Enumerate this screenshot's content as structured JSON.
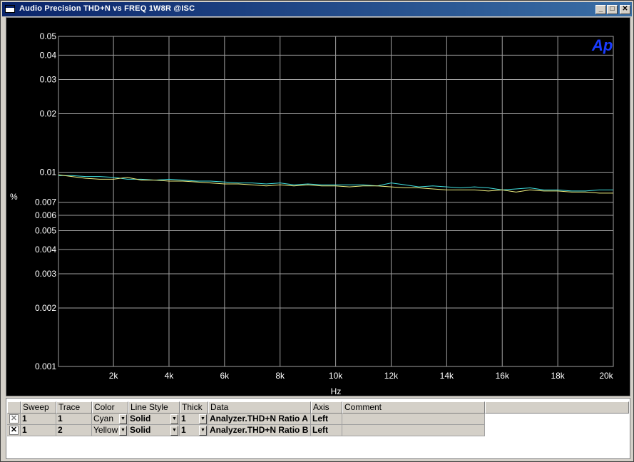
{
  "window": {
    "title": "Audio Precision  THD+N vs FREQ 1W8R @ISC",
    "min_glyph": "_",
    "max_glyph": "□",
    "close_glyph": "✕"
  },
  "logo": "Ap",
  "chart_data": {
    "type": "line",
    "xlabel": "Hz",
    "ylabel": "%",
    "xlim": [
      20,
      20000
    ],
    "ylim": [
      0.001,
      0.05
    ],
    "yscale": "log",
    "grid": true,
    "x_ticks": [
      {
        "v": 2000,
        "label": "2k"
      },
      {
        "v": 4000,
        "label": "4k"
      },
      {
        "v": 6000,
        "label": "6k"
      },
      {
        "v": 8000,
        "label": "8k"
      },
      {
        "v": 10000,
        "label": "10k"
      },
      {
        "v": 12000,
        "label": "12k"
      },
      {
        "v": 14000,
        "label": "14k"
      },
      {
        "v": 16000,
        "label": "16k"
      },
      {
        "v": 18000,
        "label": "18k"
      },
      {
        "v": 20000,
        "label": "20k"
      }
    ],
    "y_ticks": [
      {
        "v": 0.05,
        "label": "0.05"
      },
      {
        "v": 0.04,
        "label": "0.04"
      },
      {
        "v": 0.03,
        "label": "0.03"
      },
      {
        "v": 0.02,
        "label": "0.02"
      },
      {
        "v": 0.01,
        "label": "0.01"
      },
      {
        "v": 0.007,
        "label": "0.007"
      },
      {
        "v": 0.006,
        "label": "0.006"
      },
      {
        "v": 0.005,
        "label": "0.005"
      },
      {
        "v": 0.004,
        "label": "0.004"
      },
      {
        "v": 0.003,
        "label": "0.003"
      },
      {
        "v": 0.002,
        "label": "0.002"
      },
      {
        "v": 0.001,
        "label": "0.001"
      }
    ],
    "series": [
      {
        "color": "#40e0e0",
        "x": [
          20,
          500,
          1000,
          1500,
          2000,
          2500,
          3000,
          3500,
          4000,
          4500,
          5000,
          5500,
          6000,
          6500,
          7000,
          7500,
          8000,
          8500,
          9000,
          9500,
          10000,
          10500,
          11000,
          11500,
          12000,
          12500,
          13000,
          13500,
          14000,
          14500,
          15000,
          15500,
          16000,
          16500,
          17000,
          17500,
          18000,
          18500,
          19000,
          19500,
          20000
        ],
        "y": [
          0.0096,
          0.0096,
          0.0095,
          0.0095,
          0.0094,
          0.0092,
          0.0092,
          0.0091,
          0.0092,
          0.0091,
          0.009,
          0.009,
          0.0089,
          0.0088,
          0.0088,
          0.0087,
          0.0088,
          0.0086,
          0.0087,
          0.0086,
          0.0086,
          0.0086,
          0.0086,
          0.0085,
          0.0088,
          0.0086,
          0.0084,
          0.0085,
          0.0084,
          0.0083,
          0.0084,
          0.0083,
          0.0081,
          0.0082,
          0.0083,
          0.0081,
          0.0081,
          0.008,
          0.008,
          0.0081,
          0.0081
        ]
      },
      {
        "color": "#f0f080",
        "x": [
          20,
          500,
          1000,
          1500,
          2000,
          2500,
          3000,
          3500,
          4000,
          4500,
          5000,
          5500,
          6000,
          6500,
          7000,
          7500,
          8000,
          8500,
          9000,
          9500,
          10000,
          10500,
          11000,
          11500,
          12000,
          12500,
          13000,
          13500,
          14000,
          14500,
          15000,
          15500,
          16000,
          16500,
          17000,
          17500,
          18000,
          18500,
          19000,
          19500,
          20000
        ],
        "y": [
          0.0097,
          0.0095,
          0.0093,
          0.0092,
          0.0092,
          0.0094,
          0.0091,
          0.0091,
          0.009,
          0.009,
          0.0089,
          0.0088,
          0.0087,
          0.0087,
          0.0086,
          0.0085,
          0.0086,
          0.0085,
          0.0086,
          0.0085,
          0.0085,
          0.0084,
          0.0085,
          0.0085,
          0.0084,
          0.0083,
          0.0083,
          0.0082,
          0.0081,
          0.0081,
          0.0081,
          0.008,
          0.0081,
          0.0079,
          0.0081,
          0.008,
          0.008,
          0.0079,
          0.0079,
          0.0078,
          0.0078
        ]
      }
    ]
  },
  "table": {
    "columns": [
      "Sweep",
      "Trace",
      "Color",
      "Line Style",
      "Thick",
      "Data",
      "Axis",
      "Comment"
    ],
    "rows": [
      {
        "checked": "✕",
        "sweep": "1",
        "trace": "1",
        "color": "Cyan",
        "line_style": "Solid",
        "thick": "1",
        "data": "Analyzer.THD+N Ratio A",
        "axis": "Left",
        "comment": ""
      },
      {
        "checked": "✕",
        "sweep": "1",
        "trace": "2",
        "color": "Yellow",
        "line_style": "Solid",
        "thick": "1",
        "data": "Analyzer.THD+N Ratio B",
        "axis": "Left",
        "comment": ""
      }
    ],
    "dropdown_glyph": "▼"
  }
}
